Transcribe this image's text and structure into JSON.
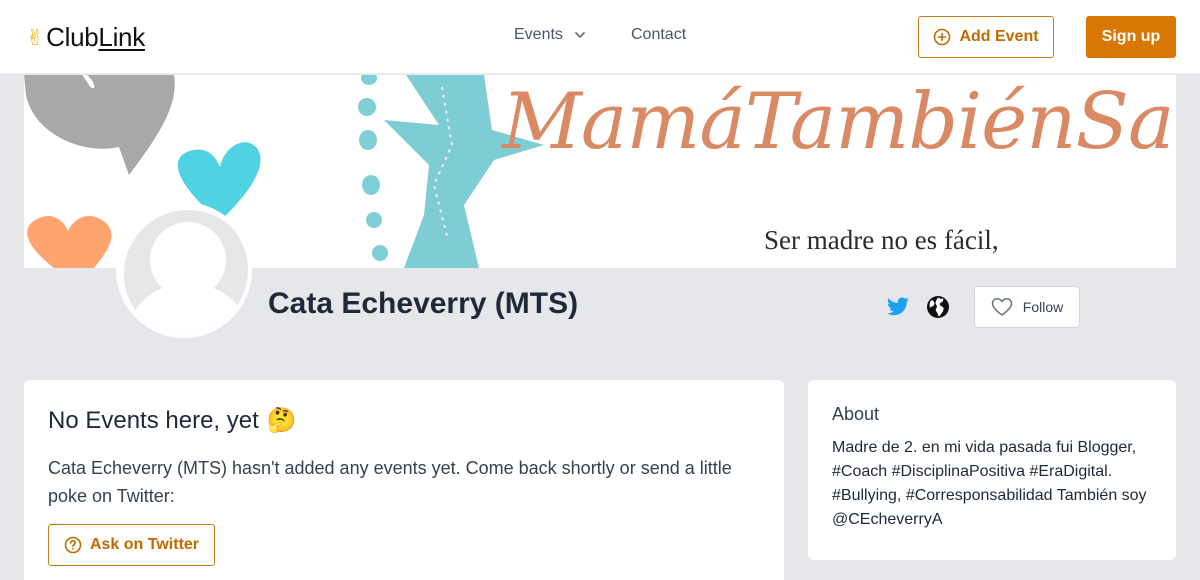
{
  "header": {
    "logo_text": "ClubLink",
    "logo_main": "Club",
    "logo_link": "Link",
    "nav": {
      "events_label": "Events",
      "contact_label": "Contact"
    },
    "add_event_label": "Add Event",
    "signup_label": "Sign up"
  },
  "banner": {
    "title": "MamáTambiénSabe",
    "subtitle": "Ser madre no es fácil,"
  },
  "profile": {
    "name": "Cata Echeverry (MTS)",
    "follow_label": "Follow"
  },
  "events": {
    "title": "No Events here, yet",
    "emoji": "🤔",
    "description": "Cata Echeverry (MTS) hasn't added any events yet. Come back shortly or send a little poke on Twitter:",
    "ask_label": "Ask on Twitter"
  },
  "about": {
    "title": "About",
    "text": "Madre de 2. en mi vida pasada fui Blogger, #Coach #DisciplinaPositiva #EraDigital. #Bullying, #Corresponsabilidad También soy @CEcheverryA"
  },
  "colors": {
    "accent": "#d97706",
    "accent_text": "#c26a00",
    "twitter": "#1da1f2",
    "background": "#e5e7eb",
    "banner_teal": "#5bc5cf",
    "banner_script": "#d98a64"
  },
  "icons": {
    "logo": "victory-hand-icon",
    "events_dropdown": "chevron-down-icon",
    "add_event": "plus-circle-icon",
    "twitter": "twitter-icon",
    "website": "globe-icon",
    "follow": "heart-outline-icon",
    "ask": "question-circle-icon"
  }
}
